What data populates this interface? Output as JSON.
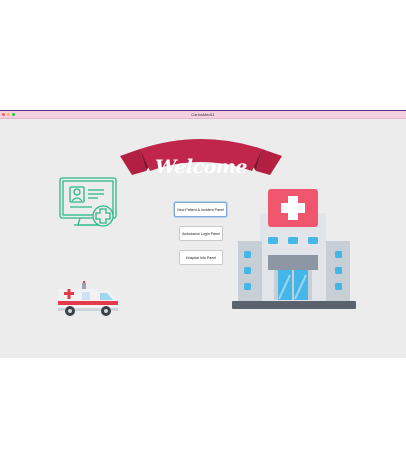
{
  "window": {
    "title": "CarlosMed11"
  },
  "banner": {
    "text": "Welcome"
  },
  "buttons": {
    "new_patient": "New Patient & Incident Panel",
    "ambulance_login": "Ambulance Login Panel",
    "hospital_info": "Hospital Info Panel"
  },
  "icons": {
    "monitor": "patient-record-monitor-icon",
    "ambulance": "ambulance-icon",
    "hospital": "hospital-building-icon"
  },
  "colors": {
    "banner_red": "#c0264a",
    "banner_dark": "#7d1730",
    "monitor_green": "#2bb887",
    "hospital_pink": "#f0566e",
    "hospital_blue": "#45b6e8",
    "hospital_grey": "#c8ced6"
  }
}
